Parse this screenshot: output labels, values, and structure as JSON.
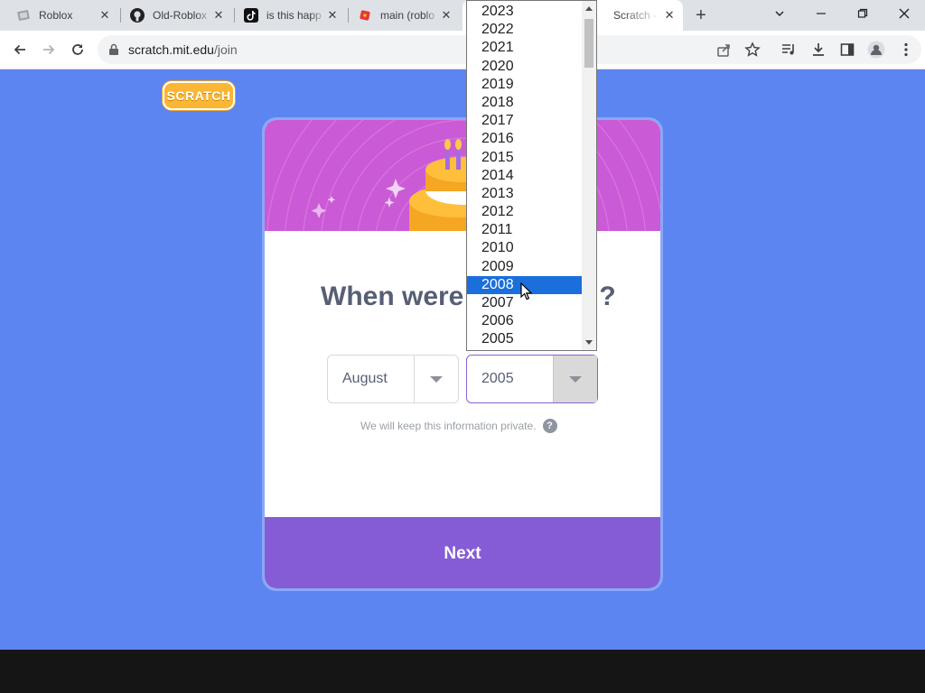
{
  "browser": {
    "tabs": [
      {
        "title": "Roblox",
        "icon": "roblox-tab-icon",
        "active": false
      },
      {
        "title": "Old-Roblox",
        "icon": "github-icon",
        "active": false
      },
      {
        "title": "is this happ",
        "icon": "tiktok-icon",
        "active": false
      },
      {
        "title": "main (roblo",
        "icon": "roblox-favicon-icon",
        "active": false
      },
      {
        "title": "Scratch - Jo",
        "icon": "scratch-icon",
        "active": true
      }
    ],
    "close_glyph": "✕",
    "new_tab_glyph": "+",
    "url_host": "scratch.mit.edu",
    "url_path": "/join"
  },
  "page": {
    "logo_text": "SCRATCH",
    "question_visible": "When were",
    "question_tail": "?",
    "month_select": {
      "value": "August"
    },
    "year_select": {
      "value": "2005"
    },
    "private_note": "We will keep this information private.",
    "help_glyph": "?",
    "next_label": "Next"
  },
  "year_dropdown": {
    "options": [
      "2023",
      "2022",
      "2021",
      "2020",
      "2019",
      "2018",
      "2017",
      "2016",
      "2015",
      "2014",
      "2013",
      "2012",
      "2011",
      "2010",
      "2009",
      "2008",
      "2007",
      "2006",
      "2005"
    ],
    "highlighted": "2008"
  },
  "colors": {
    "page_bg": "#5c85f1",
    "banner": "#cb5ad6",
    "next_button": "#855cd6",
    "highlight": "#1a6fdc",
    "logo": "#fbb634"
  }
}
